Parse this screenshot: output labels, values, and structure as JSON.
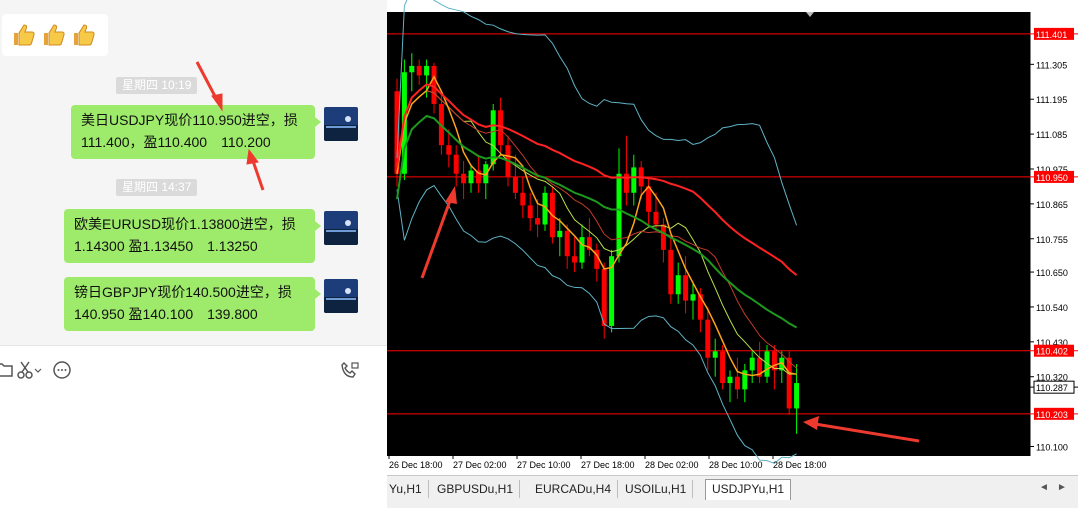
{
  "chat": {
    "timestamps": [
      "星期四 10:19",
      "星期四 14:37"
    ],
    "messages": [
      {
        "text": "美日USDJPY现价110.950进空，损111.400，盈110.400　110.200"
      },
      {
        "text": "欧美EURUSD现价1.13800进空，损1.14300  盈1.13450　1.13250"
      },
      {
        "text": "镑日GBPJPY现价140.500进空，损140.950   盈140.100　139.800"
      }
    ],
    "emoji_bubble": {
      "icons": [
        "thumbs-up-icon",
        "thumbs-up-icon",
        "thumbs-up-icon"
      ]
    },
    "toolbar_icons": [
      "scissors-icon",
      "chat-bubble-icon",
      "video-call-icon"
    ]
  },
  "tabs": [
    {
      "label": "Yu,H1",
      "active": false
    },
    {
      "label": "GBPUSDu,H1",
      "active": false
    },
    {
      "label": "EURCADu,H4",
      "active": false
    },
    {
      "label": "USOILu,H1",
      "active": false
    },
    {
      "label": "USDJPYu,H1",
      "active": true
    }
  ],
  "colors": {
    "bull": "#00ff00",
    "bear": "#ff0000",
    "chat_bubble": "#9eea6a",
    "arrow": "#ee3a2e"
  },
  "chart_data": {
    "type": "candlestick",
    "symbol": "USDJPYu,H1",
    "ylim": [
      110.07,
      111.47
    ],
    "y_ticks": [
      111.305,
      111.195,
      111.085,
      110.975,
      110.865,
      110.755,
      110.65,
      110.54,
      110.43,
      110.32,
      110.1
    ],
    "x_ticks": [
      "26 Dec 18:00",
      "27 Dec 02:00",
      "27 Dec 10:00",
      "27 Dec 18:00",
      "28 Dec 02:00",
      "28 Dec 10:00",
      "28 Dec 18:00"
    ],
    "h_lines": [
      {
        "value": 111.401,
        "label": "111.401",
        "color": "#ff0000",
        "labeled": true
      },
      {
        "value": 110.95,
        "label": "110.950",
        "color": "#ff0000",
        "labeled": true
      },
      {
        "value": 110.402,
        "label": "110.402",
        "color": "#ff0000",
        "labeled": true
      },
      {
        "value": 110.287,
        "label": "110.287",
        "color": "#000000",
        "labeled": false
      },
      {
        "value": 110.203,
        "label": "110.203",
        "color": "#ff0000",
        "labeled": true
      }
    ],
    "candles": [
      [
        111.22,
        111.26,
        110.92,
        110.96
      ],
      [
        110.96,
        111.32,
        110.94,
        111.28
      ],
      [
        111.28,
        111.34,
        111.22,
        111.3
      ],
      [
        111.3,
        111.32,
        111.24,
        111.27
      ],
      [
        111.27,
        111.32,
        111.2,
        111.3
      ],
      [
        111.3,
        111.31,
        111.15,
        111.18
      ],
      [
        111.18,
        111.22,
        111.02,
        111.05
      ],
      [
        111.05,
        111.1,
        110.98,
        111.02
      ],
      [
        111.02,
        111.05,
        110.92,
        110.96
      ],
      [
        110.96,
        111.0,
        110.88,
        110.93
      ],
      [
        110.93,
        110.99,
        110.9,
        110.97
      ],
      [
        110.97,
        111.02,
        110.9,
        110.93
      ],
      [
        110.93,
        111.0,
        110.88,
        110.99
      ],
      [
        110.99,
        111.18,
        110.97,
        111.16
      ],
      [
        111.16,
        111.2,
        111.02,
        111.05
      ],
      [
        111.05,
        111.08,
        110.92,
        110.95
      ],
      [
        110.95,
        111.02,
        110.88,
        110.9
      ],
      [
        110.9,
        110.95,
        110.82,
        110.86
      ],
      [
        110.86,
        110.9,
        110.78,
        110.82
      ],
      [
        110.82,
        110.88,
        110.76,
        110.8
      ],
      [
        110.8,
        110.92,
        110.78,
        110.9
      ],
      [
        110.9,
        110.92,
        110.74,
        110.76
      ],
      [
        110.76,
        110.82,
        110.7,
        110.78
      ],
      [
        110.78,
        110.8,
        110.66,
        110.7
      ],
      [
        110.7,
        110.76,
        110.65,
        110.68
      ],
      [
        110.68,
        110.8,
        110.66,
        110.76
      ],
      [
        110.76,
        110.82,
        110.7,
        110.72
      ],
      [
        110.72,
        110.74,
        110.62,
        110.66
      ],
      [
        110.66,
        110.68,
        110.44,
        110.48
      ],
      [
        110.48,
        110.72,
        110.46,
        110.7
      ],
      [
        110.7,
        111.04,
        110.68,
        110.96
      ],
      [
        110.96,
        111.08,
        110.86,
        110.9
      ],
      [
        110.9,
        111.02,
        110.86,
        110.98
      ],
      [
        110.98,
        111.0,
        110.88,
        110.92
      ],
      [
        110.92,
        110.95,
        110.8,
        110.84
      ],
      [
        110.84,
        110.9,
        110.78,
        110.8
      ],
      [
        110.8,
        110.82,
        110.68,
        110.72
      ],
      [
        110.72,
        110.76,
        110.55,
        110.58
      ],
      [
        110.58,
        110.68,
        110.55,
        110.64
      ],
      [
        110.64,
        110.7,
        110.52,
        110.56
      ],
      [
        110.56,
        110.62,
        110.5,
        110.58
      ],
      [
        110.58,
        110.6,
        110.46,
        110.5
      ],
      [
        110.5,
        110.54,
        110.34,
        110.38
      ],
      [
        110.38,
        110.44,
        110.32,
        110.4
      ],
      [
        110.4,
        110.42,
        110.28,
        110.3
      ],
      [
        110.3,
        110.34,
        110.24,
        110.32
      ],
      [
        110.32,
        110.38,
        110.25,
        110.28
      ],
      [
        110.28,
        110.36,
        110.24,
        110.34
      ],
      [
        110.34,
        110.4,
        110.3,
        110.38
      ],
      [
        110.38,
        110.43,
        110.3,
        110.32
      ],
      [
        110.32,
        110.42,
        110.3,
        110.4
      ],
      [
        110.4,
        110.42,
        110.28,
        110.34
      ],
      [
        110.34,
        110.4,
        110.3,
        110.38
      ],
      [
        110.38,
        110.4,
        110.2,
        110.22
      ],
      [
        110.22,
        110.36,
        110.14,
        110.3
      ]
    ]
  }
}
